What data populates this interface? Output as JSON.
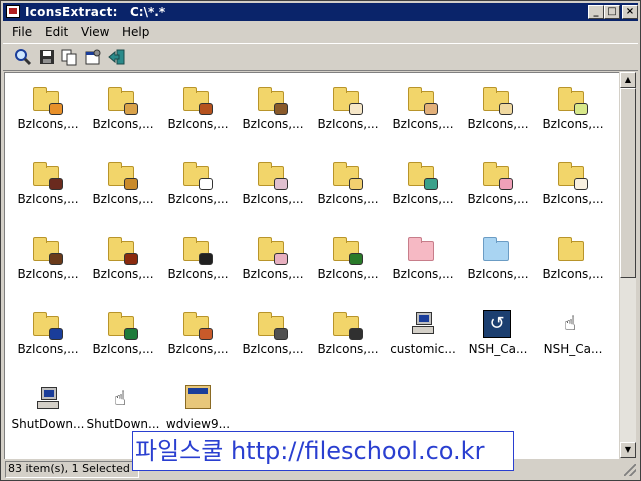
{
  "window": {
    "title": "IconsExtract:",
    "path": "C:\\*.*",
    "min_label": "_",
    "max_label": "□",
    "close_label": "×"
  },
  "menu": [
    "File",
    "Edit",
    "View",
    "Help"
  ],
  "toolbar": [
    {
      "name": "find-icon",
      "glyph": "🔍"
    },
    {
      "name": "save-icon",
      "glyph": "💾"
    },
    {
      "name": "copy-icon",
      "glyph": "📋"
    },
    {
      "name": "properties-icon",
      "glyph": "🗔"
    },
    {
      "name": "exit-icon",
      "glyph": "⇥"
    }
  ],
  "icons": [
    {
      "label": "BzIcons,...",
      "kind": "folder",
      "badge": "#e8902a"
    },
    {
      "label": "BzIcons,...",
      "kind": "folder",
      "badge": "#d9a24a"
    },
    {
      "label": "BzIcons,...",
      "kind": "folder",
      "badge": "#b5521e"
    },
    {
      "label": "BzIcons,...",
      "kind": "folder",
      "badge": "#8a5a2a"
    },
    {
      "label": "BzIcons,...",
      "kind": "folder",
      "badge": "#f6e7c8"
    },
    {
      "label": "BzIcons,...",
      "kind": "folder",
      "badge": "#e2b07a"
    },
    {
      "label": "BzIcons,...",
      "kind": "folder",
      "badge": "#f0d9a0"
    },
    {
      "label": "BzIcons,...",
      "kind": "folder",
      "badge": "#d8e88a"
    },
    {
      "label": "BzIcons,...",
      "kind": "folder",
      "badge": "#6a2a1e"
    },
    {
      "label": "BzIcons,...",
      "kind": "folder",
      "badge": "#c98a2a"
    },
    {
      "label": "BzIcons,...",
      "kind": "folder",
      "badge": "#ffffff"
    },
    {
      "label": "BzIcons,...",
      "kind": "folder",
      "badge": "#e0c0d0"
    },
    {
      "label": "BzIcons,...",
      "kind": "folder",
      "badge": "#f2d070"
    },
    {
      "label": "BzIcons,...",
      "kind": "folder",
      "badge": "#3aa08a"
    },
    {
      "label": "BzIcons,...",
      "kind": "folder",
      "badge": "#f0a0b8"
    },
    {
      "label": "BzIcons,...",
      "kind": "folder",
      "badge": "#f8f0e0"
    },
    {
      "label": "BzIcons,...",
      "kind": "folder",
      "badge": "#6a3a1a"
    },
    {
      "label": "BzIcons,...",
      "kind": "folder",
      "badge": "#8a2a0e"
    },
    {
      "label": "BzIcons,...",
      "kind": "folder",
      "badge": "#202020"
    },
    {
      "label": "BzIcons,...",
      "kind": "folder",
      "badge": "#e8b0c0"
    },
    {
      "label": "BzIcons,...",
      "kind": "folder",
      "badge": "#2a7a2a"
    },
    {
      "label": "BzIcons,...",
      "kind": "folder-pink",
      "badge": ""
    },
    {
      "label": "BzIcons,...",
      "kind": "folder-blue",
      "badge": ""
    },
    {
      "label": "BzIcons,...",
      "kind": "folder",
      "badge": ""
    },
    {
      "label": "BzIcons,...",
      "kind": "folder",
      "badge": "#1a3d9a"
    },
    {
      "label": "BzIcons,...",
      "kind": "folder",
      "badge": "#1e7a3a"
    },
    {
      "label": "BzIcons,...",
      "kind": "folder",
      "badge": "#c85a2a"
    },
    {
      "label": "BzIcons,...",
      "kind": "folder",
      "badge": "#505050"
    },
    {
      "label": "BzIcons,...",
      "kind": "folder",
      "badge": "#303030"
    },
    {
      "label": "customic...",
      "kind": "pc",
      "badge": ""
    },
    {
      "label": "NSH_Ca...",
      "kind": "nsh",
      "badge": ""
    },
    {
      "label": "NSH_Ca...",
      "kind": "hand",
      "badge": ""
    },
    {
      "label": "ShutDown...",
      "kind": "pc",
      "badge": ""
    },
    {
      "label": "ShutDown...",
      "kind": "hand",
      "badge": ""
    },
    {
      "label": "wdview9...",
      "kind": "box",
      "badge": ""
    }
  ],
  "status": {
    "text": "83 item(s), 1 Selected"
  },
  "watermark": "파일스쿨 http://fileschool.co.kr"
}
